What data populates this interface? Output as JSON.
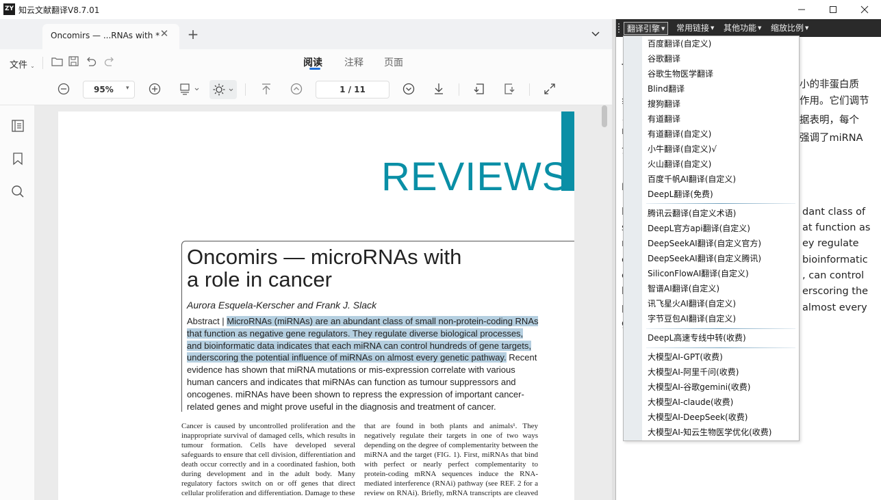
{
  "window": {
    "title": "知云文献翻译V8.7.01",
    "logo_text": "ZY"
  },
  "tab": {
    "label": "Oncomirs — ...RNAs with *"
  },
  "toolbar": {
    "file_label": "文件",
    "view_tabs": [
      "阅读",
      "注释",
      "页面"
    ],
    "zoom_value": "95%",
    "page_indicator": "1 / 11"
  },
  "document": {
    "header": "REVIEWS",
    "title_line1": "Oncomirs — microRNAs with",
    "title_line2": "a role in cancer",
    "authors": "Aurora Esquela-Kerscher and Frank J. Slack",
    "abstract_label": "Abstract |",
    "abstract_highlight": "MicroRNAs (miRNAs) are an abundant class of small non-protein-coding RNAs that function as negative gene regulators. They regulate diverse biological processes, and bioinformatic data indicates that each miRNA can control hundreds of gene targets, underscoring the potential influence of miRNAs on almost every genetic pathway.",
    "abstract_rest": " Recent evidence has shown that miRNA mutations or mis-expression correlate with various human cancers and indicates that miRNAs can function as tumour suppressors and oncogenes. miRNAs have been shown to repress the expression of important cancer-related genes and might prove useful in the diagnosis and treatment of cancer.",
    "col1": "Cancer is caused by uncontrolled proliferation and the inappropriate survival of damaged cells, which results in tumour formation. Cells have developed several safeguards to ensure that cell division, differentiation and death occur correctly and in a coordinated fashion, both during development and in the adult body. Many regulatory factors switch on or off genes that direct cellular proliferation and differentiation. Damage to these",
    "col2": "that are found in both plants and animals¹. They negatively regulate their targets in one of two ways depending on the degree of complementarity between the miRNA and the target (FIG. 1). First, miRNAs that bind with perfect or nearly perfect complementarity to protein-coding mRNA sequences induce the RNA-mediated interference (RNAi) pathway (see REF. 2 for a review on RNAi). Briefly, mRNA transcripts are cleaved by ribo-"
  },
  "translation_panel": {
    "menus": [
      "翻译引擎",
      "常用链接",
      "其他功能",
      "缩放比例"
    ],
    "visible_fragments": {
      "r1": "小的非蛋白质",
      "r2": "作用。它们调节",
      "r3": "据表明，每个",
      "r4": "强调了miRNA",
      "e1": "dant class of",
      "e2": "at function as",
      "e3": "ey  regulate",
      "e4": "bioinformatic",
      "e5": ", can control",
      "e6": "erscoring the",
      "e7": "almost every",
      "l1": "言",
      "l2": "彳",
      "l3": "纟",
      "l4": "ス",
      "l5": "r",
      "l6": "氵",
      "l7": "Ⅰ",
      "l8": "l",
      "l9": "s",
      "l10": "r",
      "l11": "c",
      "l12": "c",
      "l13": "h",
      "l14": "p",
      "l15": "g"
    }
  },
  "engine_dropdown": {
    "items": [
      "百度翻译(自定义)",
      "谷歌翻译",
      "谷歌生物医学翻译",
      "Blind翻译",
      "搜狗翻译",
      "有道翻译",
      "有道翻译(自定义)",
      "小牛翻译(自定义)√",
      "火山翻译(自定义)",
      "百度千帆AI翻译(自定义)",
      "DeepL翻译(免费)",
      "腾讯云翻译(自定义术语)",
      "DeepL官方api翻译(自定义)",
      "DeepSeekAI翻译(自定义官方)",
      "DeepSeekAI翻译(自定义腾讯)",
      "SiliconFlowAI翻译(自定义)",
      "智谱AI翻译(自定义)",
      "讯飞星火AI翻译(自定义)",
      "字节豆包AI翻译(自定义)",
      "DeepL高速专线中转(收费)",
      "大模型AI-GPT(收费)",
      "大模型AI-阿里千问(收费)",
      "大模型AI-谷歌gemini(收费)",
      "大模型AI-claude(收费)",
      "大模型AI-DeepSeek(收费)",
      "大模型AI-知云生物医学优化(收费)"
    ]
  }
}
